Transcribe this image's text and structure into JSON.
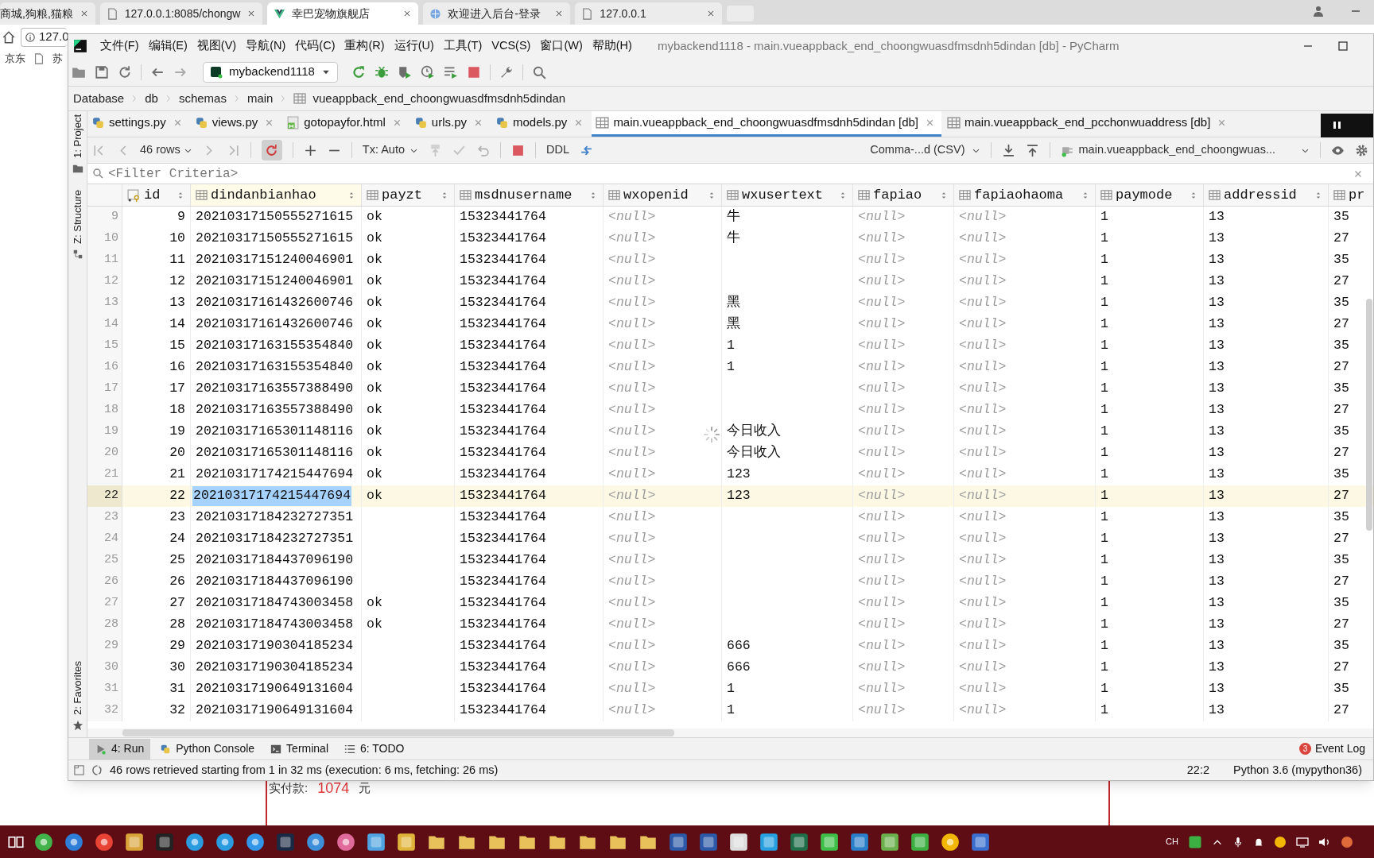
{
  "browser": {
    "tabs": [
      {
        "title": "商城,狗粮,猫粮",
        "selected": false,
        "kind": "text"
      },
      {
        "title": "127.0.0.1:8085/chongw",
        "selected": false,
        "kind": "page"
      },
      {
        "title": "幸巴宠物旗舰店",
        "selected": true,
        "kind": "vue"
      },
      {
        "title": "欢迎进入后台-登录",
        "selected": false,
        "kind": "globe"
      },
      {
        "title": "127.0.0.1",
        "selected": false,
        "kind": "page"
      }
    ],
    "address": "127.0",
    "bookmarks": [
      "京东",
      "苏"
    ],
    "page": {
      "label": "实付款:",
      "amount": "1074",
      "unit": "元"
    }
  },
  "window": {
    "title": "mybackend1118 - main.vueappback_end_choongwuasdfmsdnh5dindan [db] - PyCharm",
    "menu": [
      "文件(F)",
      "编辑(E)",
      "视图(V)",
      "导航(N)",
      "代码(C)",
      "重构(R)",
      "运行(U)",
      "工具(T)",
      "VCS(S)",
      "窗口(W)",
      "帮助(H)"
    ]
  },
  "toolbar": {
    "run_config": "mybackend1118"
  },
  "breadcrumbs": [
    "Database",
    "db",
    "schemas",
    "main",
    "vueappback_end_choongwuasdfmsdnh5dindan"
  ],
  "side_tool_windows": [
    "1: Project",
    "Z: Structure",
    "2: Favorites"
  ],
  "editor_tabs": [
    {
      "label": "settings.py",
      "kind": "python",
      "selected": false
    },
    {
      "label": "views.py",
      "kind": "python",
      "selected": false
    },
    {
      "label": "gotopayfor.html",
      "kind": "html",
      "selected": false
    },
    {
      "label": "urls.py",
      "kind": "python",
      "selected": false
    },
    {
      "label": "models.py",
      "kind": "python",
      "selected": false
    },
    {
      "label": "main.vueappback_end_choongwuasdfmsdnh5dindan [db]",
      "kind": "table",
      "selected": true
    },
    {
      "label": "main.vueappback_end_pcchonwuaddress [db]",
      "kind": "table",
      "selected": false
    }
  ],
  "grid_toolbar": {
    "rows": "46 rows",
    "tx": "Tx: Auto",
    "ddl": "DDL",
    "export": "Comma-...d (CSV)",
    "target": "main.vueappback_end_choongwuas..."
  },
  "filter": {
    "placeholder": "<Filter Criteria>"
  },
  "table": {
    "loading": true,
    "columns": [
      {
        "label": "id",
        "kind": "key"
      },
      {
        "label": "dindanbianhao",
        "kind": "column"
      },
      {
        "label": "payzt",
        "kind": "column"
      },
      {
        "label": "msdnusername",
        "kind": "column"
      },
      {
        "label": "wxopenid",
        "kind": "column"
      },
      {
        "label": "wxusertext",
        "kind": "column"
      },
      {
        "label": "fapiao",
        "kind": "column"
      },
      {
        "label": "fapiaohaoma",
        "kind": "column"
      },
      {
        "label": "paymode",
        "kind": "column"
      },
      {
        "label": "addressid",
        "kind": "column"
      },
      {
        "label": "pr",
        "kind": "column"
      }
    ],
    "rows": [
      {
        "number": "9",
        "selected": false,
        "cells": [
          "9",
          "20210317150555271615",
          "ok",
          "15323441764",
          {
            "null": "<null>"
          },
          "牛",
          {
            "null": "<null>"
          },
          {
            "null": "<null>"
          },
          "1",
          "13",
          "35"
        ]
      },
      {
        "number": "10",
        "selected": false,
        "cells": [
          "10",
          "20210317150555271615",
          "ok",
          "15323441764",
          {
            "null": "<null>"
          },
          "牛",
          {
            "null": "<null>"
          },
          {
            "null": "<null>"
          },
          "1",
          "13",
          "27"
        ]
      },
      {
        "number": "11",
        "selected": false,
        "cells": [
          "11",
          "20210317151240046901",
          "ok",
          "15323441764",
          {
            "null": "<null>"
          },
          null,
          {
            "null": "<null>"
          },
          {
            "null": "<null>"
          },
          "1",
          "13",
          "35"
        ]
      },
      {
        "number": "12",
        "selected": false,
        "cells": [
          "12",
          "20210317151240046901",
          "ok",
          "15323441764",
          {
            "null": "<null>"
          },
          null,
          {
            "null": "<null>"
          },
          {
            "null": "<null>"
          },
          "1",
          "13",
          "27"
        ]
      },
      {
        "number": "13",
        "selected": false,
        "cells": [
          "13",
          "20210317161432600746",
          "ok",
          "15323441764",
          {
            "null": "<null>"
          },
          "黑",
          {
            "null": "<null>"
          },
          {
            "null": "<null>"
          },
          "1",
          "13",
          "35"
        ]
      },
      {
        "number": "14",
        "selected": false,
        "cells": [
          "14",
          "20210317161432600746",
          "ok",
          "15323441764",
          {
            "null": "<null>"
          },
          "黑",
          {
            "null": "<null>"
          },
          {
            "null": "<null>"
          },
          "1",
          "13",
          "27"
        ]
      },
      {
        "number": "15",
        "selected": false,
        "cells": [
          "15",
          "20210317163155354840",
          "ok",
          "15323441764",
          {
            "null": "<null>"
          },
          "1",
          {
            "null": "<null>"
          },
          {
            "null": "<null>"
          },
          "1",
          "13",
          "35"
        ]
      },
      {
        "number": "16",
        "selected": false,
        "cells": [
          "16",
          "20210317163155354840",
          "ok",
          "15323441764",
          {
            "null": "<null>"
          },
          "1",
          {
            "null": "<null>"
          },
          {
            "null": "<null>"
          },
          "1",
          "13",
          "27"
        ]
      },
      {
        "number": "17",
        "selected": false,
        "cells": [
          "17",
          "20210317163557388490",
          "ok",
          "15323441764",
          {
            "null": "<null>"
          },
          null,
          {
            "null": "<null>"
          },
          {
            "null": "<null>"
          },
          "1",
          "13",
          "35"
        ]
      },
      {
        "number": "18",
        "selected": false,
        "cells": [
          "18",
          "20210317163557388490",
          "ok",
          "15323441764",
          {
            "null": "<null>"
          },
          null,
          {
            "null": "<null>"
          },
          {
            "null": "<null>"
          },
          "1",
          "13",
          "27"
        ]
      },
      {
        "number": "19",
        "selected": false,
        "cells": [
          "19",
          "20210317165301148116",
          "ok",
          "15323441764",
          {
            "null": "<null>"
          },
          "今日收入",
          {
            "null": "<null>"
          },
          {
            "null": "<null>"
          },
          "1",
          "13",
          "35"
        ]
      },
      {
        "number": "20",
        "selected": false,
        "cells": [
          "20",
          "20210317165301148116",
          "ok",
          "15323441764",
          {
            "null": "<null>"
          },
          "今日收入",
          {
            "null": "<null>"
          },
          {
            "null": "<null>"
          },
          "1",
          "13",
          "27"
        ]
      },
      {
        "number": "21",
        "selected": false,
        "cells": [
          "21",
          "20210317174215447694",
          "ok",
          "15323441764",
          {
            "null": "<null>"
          },
          "123",
          {
            "null": "<null>"
          },
          {
            "null": "<null>"
          },
          "1",
          "13",
          "35"
        ]
      },
      {
        "number": "22",
        "selected": true,
        "cells": [
          "22",
          {
            "text": "20210317174215447694",
            "current": true
          },
          "ok",
          "15323441764",
          {
            "null": "<null>"
          },
          "123",
          {
            "null": "<null>"
          },
          {
            "null": "<null>"
          },
          "1",
          "13",
          "27"
        ]
      },
      {
        "number": "23",
        "selected": false,
        "cells": [
          "23",
          "20210317184232727351",
          null,
          "15323441764",
          {
            "null": "<null>"
          },
          null,
          {
            "null": "<null>"
          },
          {
            "null": "<null>"
          },
          "1",
          "13",
          "35"
        ]
      },
      {
        "number": "24",
        "selected": false,
        "cells": [
          "24",
          "20210317184232727351",
          null,
          "15323441764",
          {
            "null": "<null>"
          },
          null,
          {
            "null": "<null>"
          },
          {
            "null": "<null>"
          },
          "1",
          "13",
          "27"
        ]
      },
      {
        "number": "25",
        "selected": false,
        "cells": [
          "25",
          "20210317184437096190",
          null,
          "15323441764",
          {
            "null": "<null>"
          },
          null,
          {
            "null": "<null>"
          },
          {
            "null": "<null>"
          },
          "1",
          "13",
          "35"
        ]
      },
      {
        "number": "26",
        "selected": false,
        "cells": [
          "26",
          "20210317184437096190",
          null,
          "15323441764",
          {
            "null": "<null>"
          },
          null,
          {
            "null": "<null>"
          },
          {
            "null": "<null>"
          },
          "1",
          "13",
          "27"
        ]
      },
      {
        "number": "27",
        "selected": false,
        "cells": [
          "27",
          "20210317184743003458",
          "ok",
          "15323441764",
          {
            "null": "<null>"
          },
          null,
          {
            "null": "<null>"
          },
          {
            "null": "<null>"
          },
          "1",
          "13",
          "35"
        ]
      },
      {
        "number": "28",
        "selected": false,
        "cells": [
          "28",
          "20210317184743003458",
          "ok",
          "15323441764",
          {
            "null": "<null>"
          },
          null,
          {
            "null": "<null>"
          },
          {
            "null": "<null>"
          },
          "1",
          "13",
          "27"
        ]
      },
      {
        "number": "29",
        "selected": false,
        "cells": [
          "29",
          "20210317190304185234",
          null,
          "15323441764",
          {
            "null": "<null>"
          },
          "666",
          {
            "null": "<null>"
          },
          {
            "null": "<null>"
          },
          "1",
          "13",
          "35"
        ]
      },
      {
        "number": "30",
        "selected": false,
        "cells": [
          "30",
          "20210317190304185234",
          null,
          "15323441764",
          {
            "null": "<null>"
          },
          "666",
          {
            "null": "<null>"
          },
          {
            "null": "<null>"
          },
          "1",
          "13",
          "27"
        ]
      },
      {
        "number": "31",
        "selected": false,
        "cells": [
          "31",
          "20210317190649131604",
          null,
          "15323441764",
          {
            "null": "<null>"
          },
          "1",
          {
            "null": "<null>"
          },
          {
            "null": "<null>"
          },
          "1",
          "13",
          "35"
        ]
      },
      {
        "number": "32",
        "selected": false,
        "cells": [
          "32",
          "20210317190649131604",
          null,
          "15323441764",
          {
            "null": "<null>"
          },
          "1",
          {
            "null": "<null>"
          },
          {
            "null": "<null>"
          },
          "1",
          "13",
          "27"
        ]
      }
    ]
  },
  "bottom_tabs": [
    {
      "label": "4: Run",
      "kind": "run",
      "selected": true
    },
    {
      "label": "Python Console",
      "kind": "python",
      "selected": false
    },
    {
      "label": "Terminal",
      "kind": "terminal",
      "selected": false
    },
    {
      "label": "6: TODO",
      "kind": "todo",
      "selected": false
    }
  ],
  "event_log": {
    "label": "Event Log",
    "badge": "3"
  },
  "status_bar": {
    "message": "46 rows retrieved starting from 1 in 32 ms (execution: 6 ms, fetching: 26 ms)",
    "position": "22:2",
    "interpreter": "Python 3.6 (mypython36)"
  },
  "taskbar": {
    "input_language": "CH"
  }
}
